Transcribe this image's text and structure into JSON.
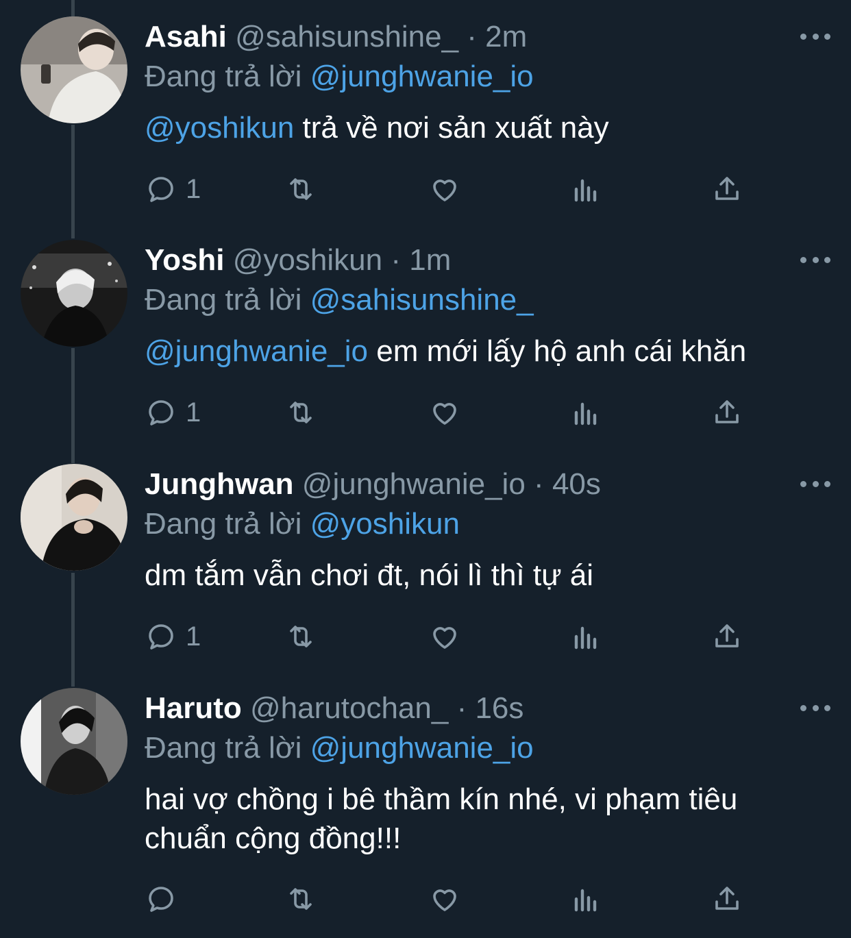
{
  "tweets": [
    {
      "name": "Asahi",
      "handle": "@sahisunshine_",
      "dot": "·",
      "time": "2m",
      "replying_prefix": "Đang trả lời",
      "replying_to": "@junghwanie_io",
      "mention": "@yoshikun",
      "text": " trả về nơi sản xuất này",
      "reply_count": "1"
    },
    {
      "name": "Yoshi",
      "handle": "@yoshikun",
      "dot": "·",
      "time": "1m",
      "replying_prefix": "Đang trả lời",
      "replying_to": "@sahisunshine_",
      "mention": "@junghwanie_io",
      "text": " em mới lấy hộ anh cái khăn",
      "reply_count": "1"
    },
    {
      "name": "Junghwan",
      "handle": "@junghwanie_io",
      "dot": "·",
      "time": "40s",
      "replying_prefix": "Đang trả lời",
      "replying_to": "@yoshikun",
      "mention": "",
      "text": "dm tắm vẫn chơi đt, nói lì thì tự ái",
      "reply_count": "1"
    },
    {
      "name": "Haruto",
      "handle": "@harutochan_",
      "dot": "·",
      "time": "16s",
      "replying_prefix": "Đang trả lời",
      "replying_to": "@junghwanie_io",
      "mention": "",
      "text": "hai vợ chồng i bê thầm kín nhé, vi phạm tiêu chuẩn cộng đồng!!!",
      "reply_count": ""
    }
  ],
  "icons": {
    "reply": "reply-icon",
    "retweet": "retweet-icon",
    "like": "heart-icon",
    "analytics": "analytics-icon",
    "share": "share-icon",
    "more": "more-icon"
  },
  "colors": {
    "background": "#15202b",
    "secondary_text": "#8899a6",
    "mention": "#4da3e6",
    "thread_line": "#38444d"
  }
}
